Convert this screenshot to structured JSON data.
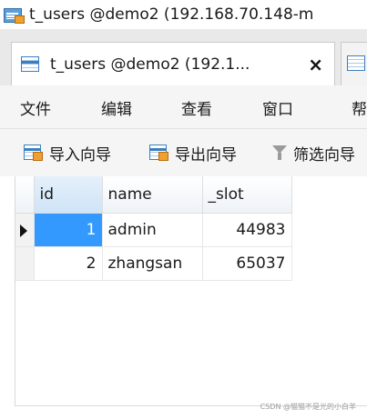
{
  "window": {
    "title": "t_users @demo2 (192.168.70.148-m"
  },
  "tabs": [
    {
      "label": "t_users @demo2 (192.1...",
      "close": "×"
    }
  ],
  "menu": {
    "items": [
      "文件",
      "编辑",
      "查看",
      "窗口",
      "帮"
    ]
  },
  "toolbar": {
    "buttons": [
      {
        "label": "导入向导",
        "icon": "import-wizard-icon"
      },
      {
        "label": "导出向导",
        "icon": "export-wizard-icon"
      },
      {
        "label": "筛选向导",
        "icon": "filter-icon"
      }
    ]
  },
  "grid": {
    "columns": [
      "id",
      "name",
      "_slot"
    ],
    "rows": [
      {
        "id": "1",
        "name": "admin",
        "slot": "44983"
      },
      {
        "id": "2",
        "name": "zhangsan",
        "slot": "65037"
      }
    ],
    "current_row_index": 0
  },
  "watermark": "CSDN @猫猫不是光的小白羊",
  "colors": {
    "selection": "#3399ff",
    "tab_background": "#e9e9e9",
    "menu_background": "#f5f5f5"
  }
}
